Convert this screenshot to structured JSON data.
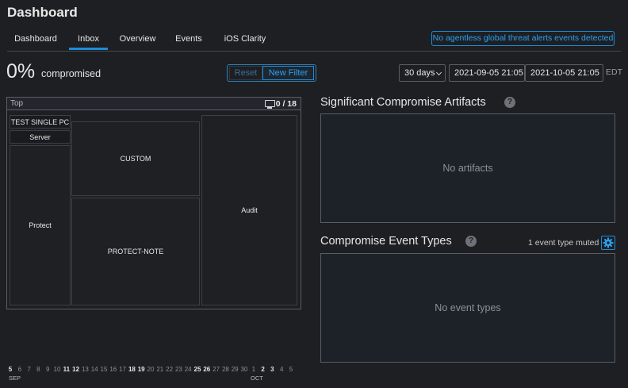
{
  "page": {
    "title": "Dashboard"
  },
  "tabs": [
    "Dashboard",
    "Inbox",
    "Overview",
    "Events",
    "iOS Clarity"
  ],
  "active_tab": "Inbox",
  "alert": {
    "text": "No agentless global threat alerts events detected"
  },
  "compromise": {
    "percent": "0%",
    "label": "compromised"
  },
  "filter": {
    "reset_label": "Reset",
    "new_label": "New Filter"
  },
  "date_range": {
    "period": "30 days",
    "start": "2021-09-05 21:05",
    "end": "2021-10-05 21:05",
    "tz": "EDT"
  },
  "top_panel": {
    "label": "Top",
    "count": "0 / 18",
    "groups": [
      "TEST SINGLE PC",
      "Server",
      "Protect",
      "CUSTOM",
      "PROTECT-NOTE",
      "Audit"
    ]
  },
  "artifacts": {
    "title": "Significant Compromise Artifacts",
    "empty_text": "No artifacts"
  },
  "event_types": {
    "title": "Compromise Event Types",
    "muted_text": "1 event type muted",
    "empty_text": "No event types"
  },
  "timeline": {
    "days": [
      {
        "d": "5",
        "b": true
      },
      {
        "d": "6"
      },
      {
        "d": "7"
      },
      {
        "d": "8"
      },
      {
        "d": "9"
      },
      {
        "d": "10"
      },
      {
        "d": "11",
        "b": true
      },
      {
        "d": "12",
        "b": true
      },
      {
        "d": "13"
      },
      {
        "d": "14"
      },
      {
        "d": "15"
      },
      {
        "d": "16"
      },
      {
        "d": "17"
      },
      {
        "d": "18",
        "b": true
      },
      {
        "d": "19",
        "b": true
      },
      {
        "d": "20"
      },
      {
        "d": "21"
      },
      {
        "d": "22"
      },
      {
        "d": "23"
      },
      {
        "d": "24"
      },
      {
        "d": "25",
        "b": true
      },
      {
        "d": "26",
        "b": true
      },
      {
        "d": "27"
      },
      {
        "d": "28"
      },
      {
        "d": "29"
      },
      {
        "d": "30"
      },
      {
        "d": "1"
      },
      {
        "d": "2",
        "b": true
      },
      {
        "d": "3",
        "b": true
      },
      {
        "d": "4"
      },
      {
        "d": "5"
      }
    ],
    "months": [
      "SEP",
      "OCT"
    ]
  },
  "colors": {
    "accent": "#1c8cd5",
    "background": "#1e1f23",
    "panel": "#1d2228"
  }
}
